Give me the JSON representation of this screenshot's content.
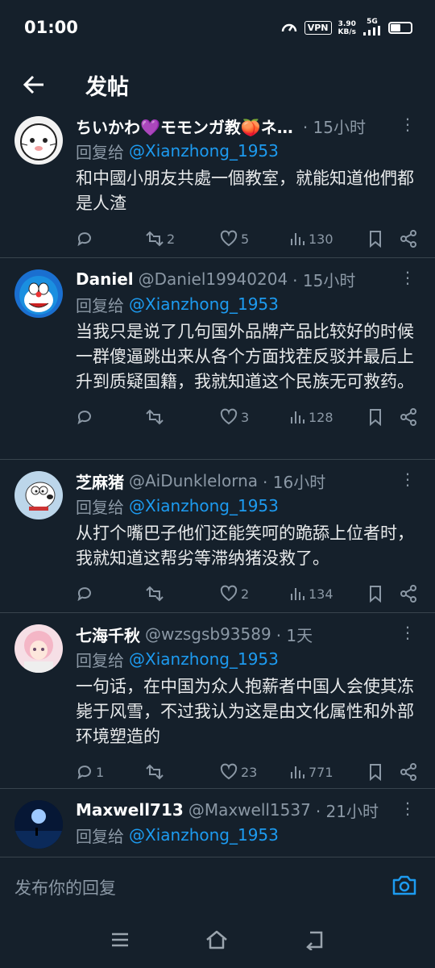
{
  "status": {
    "time": "01:00",
    "vpn": "VPN",
    "speed_value": "3.90",
    "speed_unit": "KB/s",
    "net": "5G"
  },
  "appbar": {
    "title": "发帖"
  },
  "reply_prefix": "回复给",
  "tweets": [
    {
      "name": "ちいかわ💜モモンガ教🍑ネ…",
      "handle": "",
      "time": "· 15小时",
      "reply_to": "@Xianzhong_1953",
      "text": "和中國小朋友共處一個教室，就能知道他們都是人渣",
      "replies": "",
      "retweets": "2",
      "likes": "5",
      "views": "130"
    },
    {
      "name": "Daniel",
      "handle": "@Daniel19940204",
      "time": "· 15小时",
      "reply_to": "@Xianzhong_1953",
      "text": "当我只是说了几句国外品牌产品比较好的时候一群傻逼跳出来从各个方面找茬反驳并最后上升到质疑国籍，我就知道这个民族无可救药。",
      "replies": "",
      "retweets": "",
      "likes": "3",
      "views": "128"
    },
    {
      "name": "芝麻猪",
      "handle": "@AiDunklelorna",
      "time": "· 16小时",
      "reply_to": "@Xianzhong_1953",
      "text": "从打个嘴巴子他们还能笑呵的跪舔上位者时，我就知道这帮劣等滞纳猪没救了。",
      "replies": "",
      "retweets": "",
      "likes": "2",
      "views": "134"
    },
    {
      "name": "七海千秋",
      "handle": "@wzsgsb93589",
      "time": "· 1天",
      "reply_to": "@Xianzhong_1953",
      "text": "一句话，在中国为众人抱薪者中国人会使其冻毙于风雪，不过我认为这是由文化属性和外部环境塑造的",
      "replies": "1",
      "retweets": "",
      "likes": "23",
      "views": "771"
    },
    {
      "name": "Maxwell713",
      "handle": "@Maxwell1537",
      "time": "· 21小时",
      "reply_to": "@Xianzhong_1953",
      "text": "",
      "replies": "",
      "retweets": "",
      "likes": "",
      "views": ""
    }
  ],
  "composer": {
    "placeholder": "发布你的回复"
  },
  "icons": {
    "back": "arrow-left-icon",
    "reply": "comment-icon",
    "retweet": "retweet-icon",
    "like": "heart-icon",
    "views": "bar-chart-icon",
    "bookmark": "bookmark-icon",
    "share": "share-icon",
    "camera": "camera-icon"
  },
  "colors": {
    "background": "#15202b",
    "accent": "#1d9bf0",
    "muted": "#8b98a5",
    "divider": "#38444d"
  }
}
